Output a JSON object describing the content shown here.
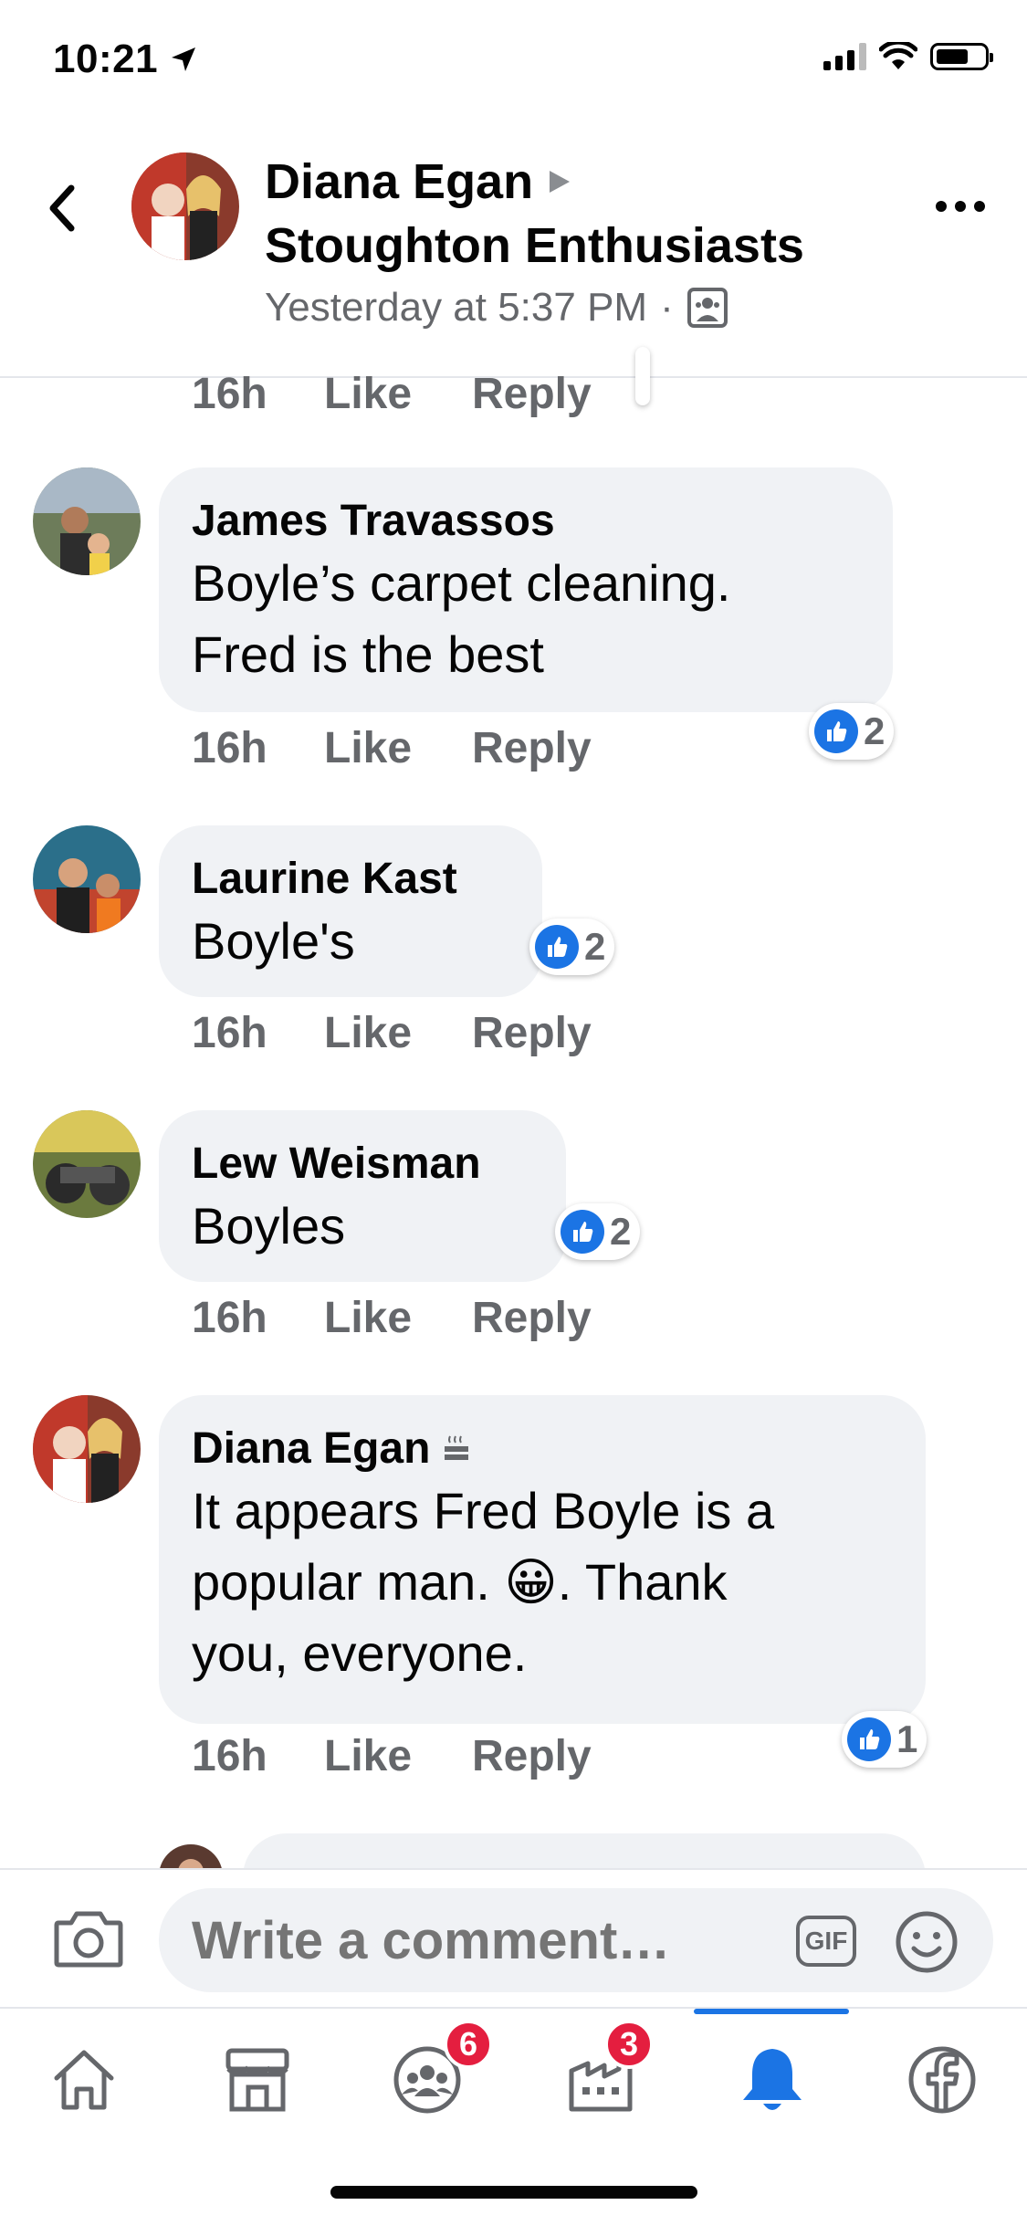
{
  "status_bar": {
    "time": "10:21"
  },
  "header": {
    "author": "Diana Egan",
    "group": "Stoughton Enthusiasts",
    "timestamp": "Yesterday at 5:37 PM",
    "separator": "·"
  },
  "partial_top_row": {
    "time": "16h",
    "like": "Like",
    "reply": "Reply"
  },
  "comments": [
    {
      "author": "James Travassos",
      "lines": [
        "Boyle’s carpet cleaning.",
        "Fred is the best"
      ],
      "reactions": "2",
      "time": "16h",
      "like": "Like",
      "reply": "Reply"
    },
    {
      "author": "Laurine Kast",
      "lines": [
        "Boyle's"
      ],
      "reactions": "2",
      "time": "16h",
      "like": "Like",
      "reply": "Reply"
    },
    {
      "author": "Lew Weisman",
      "lines": [
        "Boyles"
      ],
      "reactions": "2",
      "time": "16h",
      "like": "Like",
      "reply": "Reply"
    },
    {
      "author": "Diana Egan",
      "lines": [
        "It appears Fred Boyle is a",
        "popular man.  😀. Thank",
        "you, everyone."
      ],
      "reactions": "1",
      "time": "16h",
      "like": "Like",
      "reply": "Reply"
    }
  ],
  "compose": {
    "placeholder": "Write a comment…",
    "gif_label": "GIF"
  },
  "tabbar": {
    "items": [
      {
        "name": "home",
        "icon": "home-icon"
      },
      {
        "name": "marketplace",
        "icon": "shop-icon"
      },
      {
        "name": "groups",
        "icon": "groups-icon",
        "badge": "6"
      },
      {
        "name": "pages",
        "icon": "pages-icon",
        "badge": "3"
      },
      {
        "name": "notifications",
        "icon": "bell-icon",
        "active": true
      },
      {
        "name": "menu",
        "icon": "facebook-icon"
      }
    ]
  },
  "colors": {
    "accent": "#1b74e4",
    "badge": "#e41e3f",
    "bubble": "#f0f2f5",
    "muted": "#65676b"
  }
}
